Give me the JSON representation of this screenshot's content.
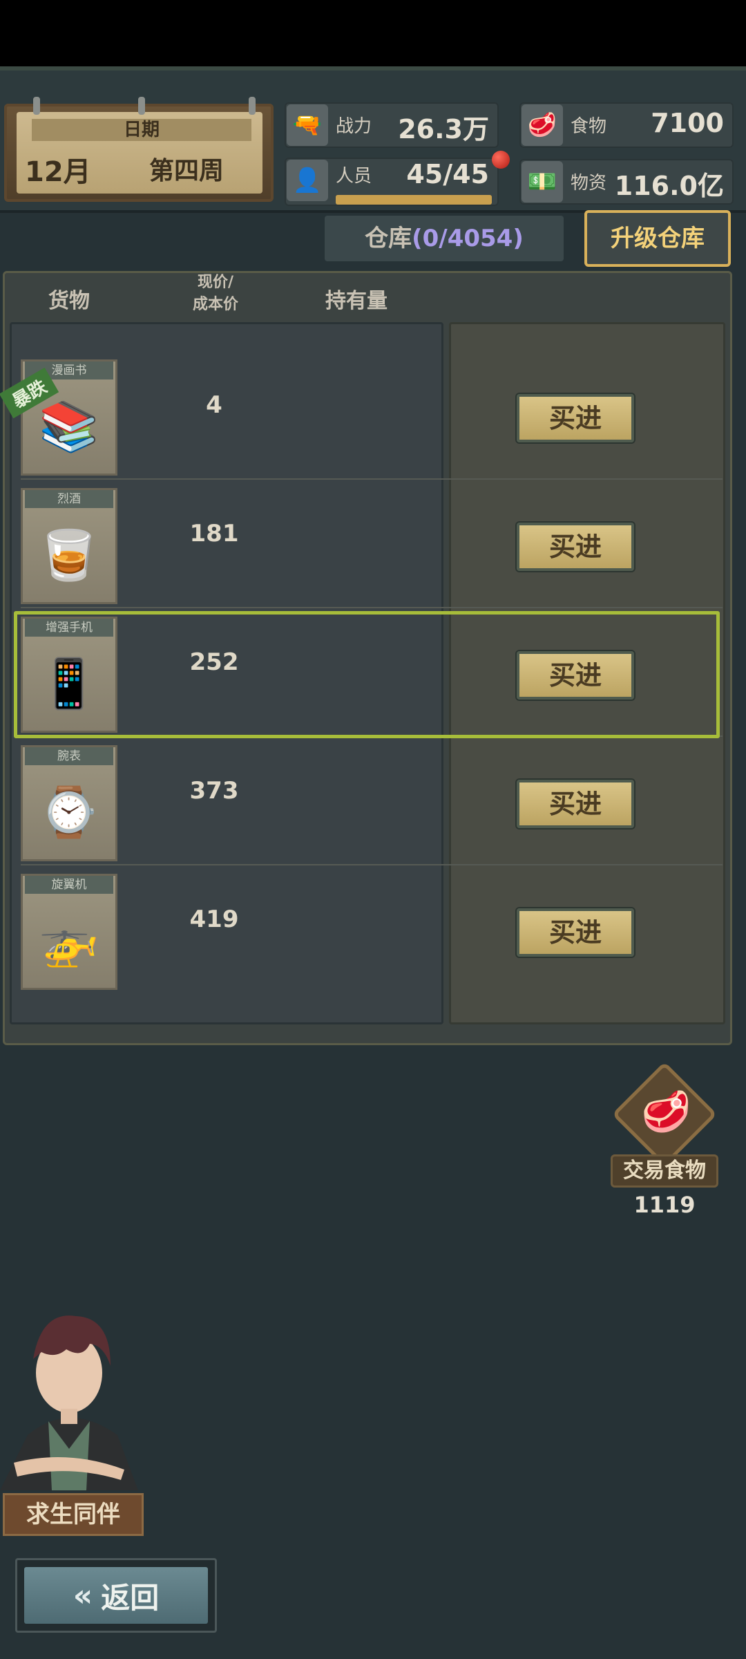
{
  "header": {
    "date_label": "日期",
    "month": "12月",
    "week": "第四周"
  },
  "stats": {
    "power": {
      "label": "战力",
      "value": "26.3万",
      "icon": "pistol-icon"
    },
    "food": {
      "label": "食物",
      "value": "7100",
      "icon": "meat-icon"
    },
    "people": {
      "label": "人员",
      "value": "45/45",
      "icon": "person-icon",
      "progress": 1.0
    },
    "supplies": {
      "label": "物资",
      "value": "116.0亿",
      "icon": "cash-icon"
    }
  },
  "warehouse": {
    "label": "仓库",
    "count": "(0/4054)",
    "upgrade_label": "升级仓库"
  },
  "table": {
    "col_goods": "货物",
    "col_price_line1": "现价/",
    "col_price_line2": "成本价",
    "col_holding": "持有量",
    "buy_label": "买进",
    "items": [
      {
        "tag": "漫画书",
        "price": "4",
        "icon": "comic-book-icon",
        "badge": "暴跌"
      },
      {
        "tag": "烈酒",
        "price": "181",
        "icon": "whiskey-bottle-icon"
      },
      {
        "tag": "增强手机",
        "price": "252",
        "icon": "radio-phone-icon",
        "selected": true
      },
      {
        "tag": "腕表",
        "price": "373",
        "icon": "wristwatch-icon"
      },
      {
        "tag": "旋翼机",
        "price": "419",
        "icon": "gyrocopter-icon"
      }
    ]
  },
  "trade": {
    "label": "交易食物",
    "count": "1119"
  },
  "companion": {
    "label": "求生同伴"
  },
  "back": {
    "label": "返回"
  },
  "colors": {
    "background": "#263236",
    "accent_gold": "#d9b15a",
    "highlight_green": "#a7bd3a",
    "warehouse_count": "#a99be8"
  }
}
